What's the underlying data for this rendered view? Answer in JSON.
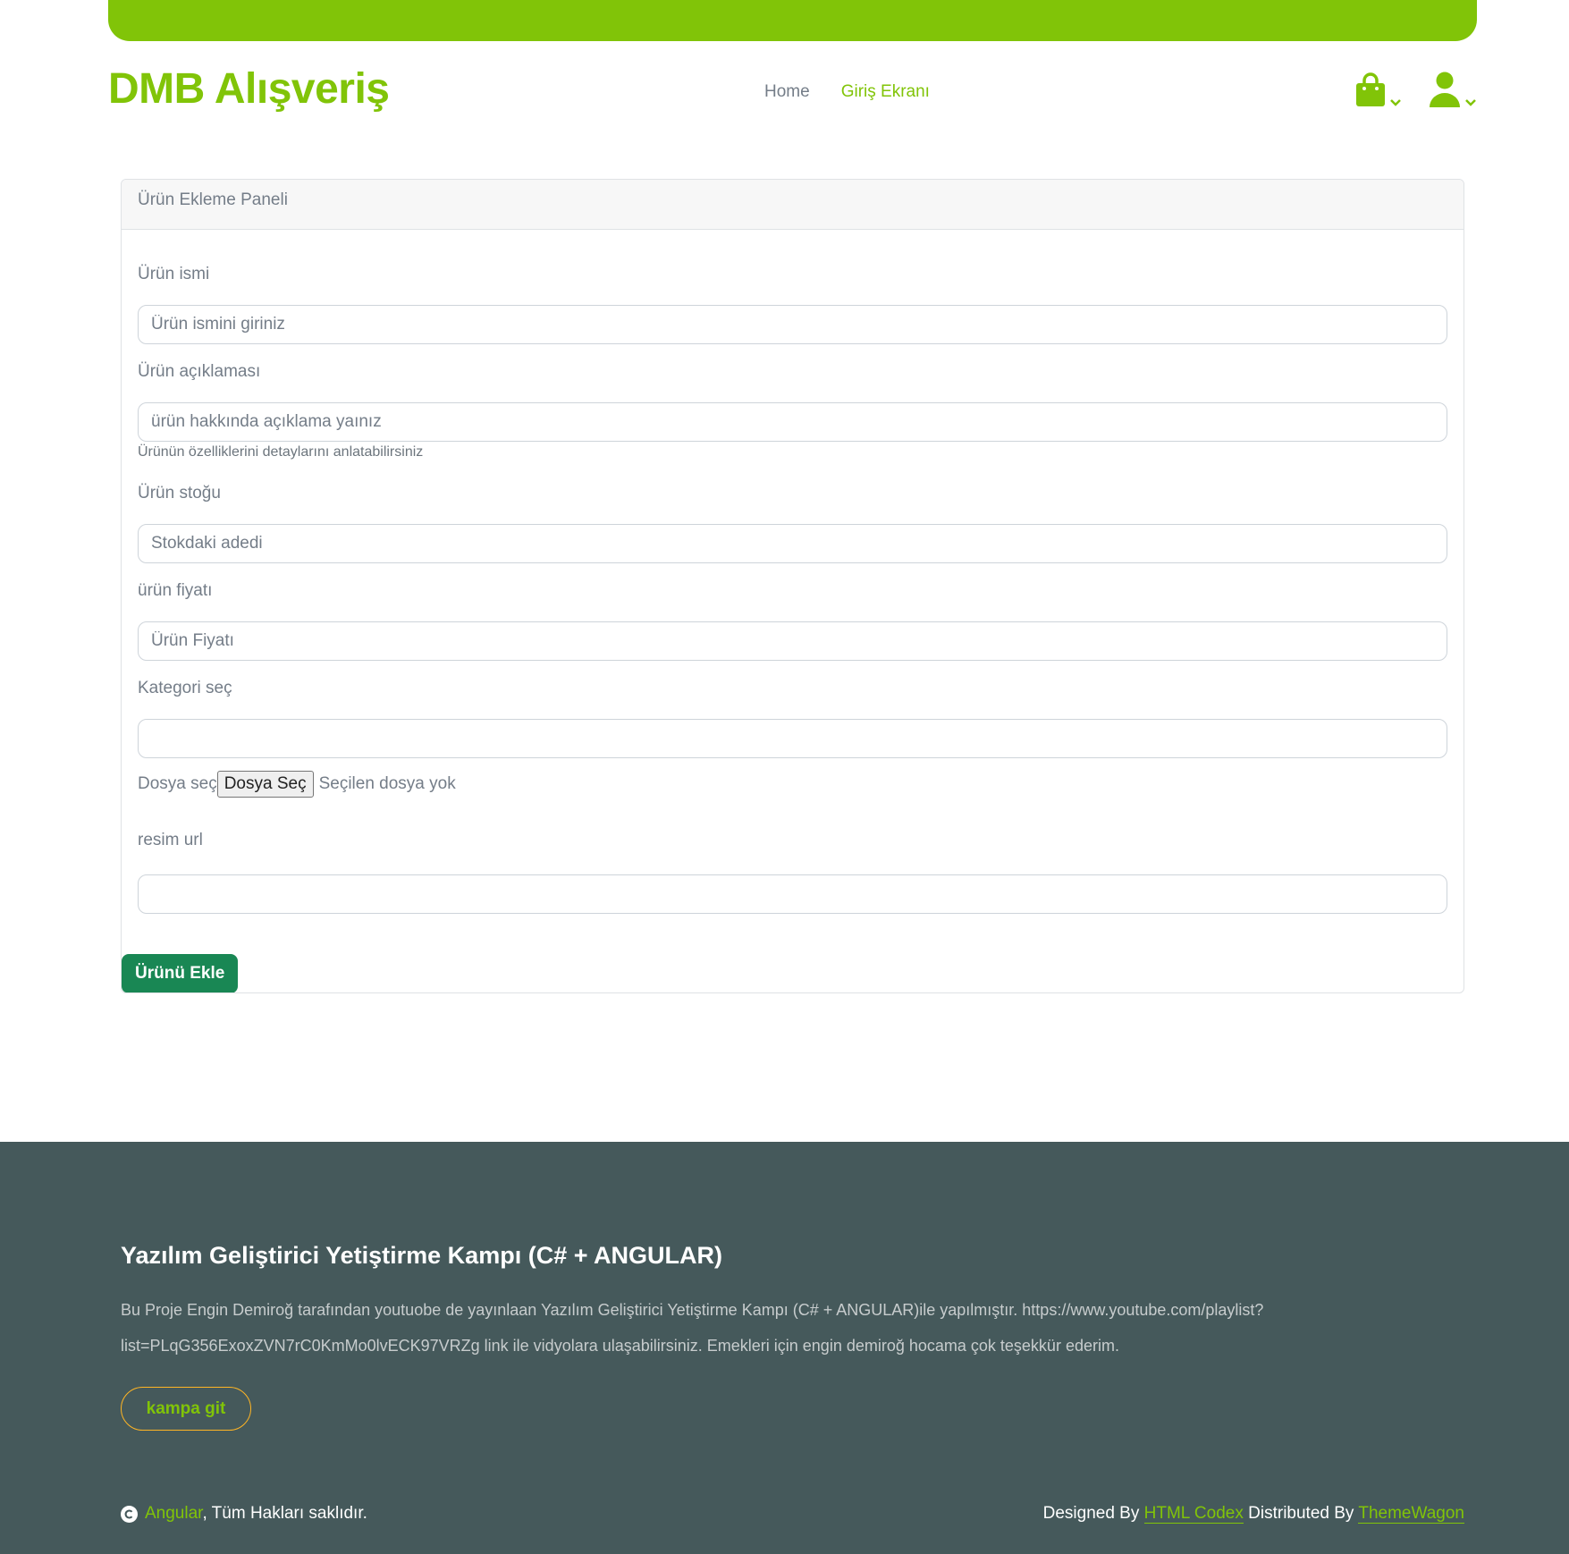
{
  "colors": {
    "brand": "#81c408",
    "footer_bg": "#45595b",
    "submit_bg": "#198754",
    "footer_btn_border": "#ffb524"
  },
  "navbar": {
    "brand": "DMB Alışveriş",
    "links": [
      {
        "label": "Home",
        "active": false
      },
      {
        "label": "Giriş Ekranı",
        "active": true
      }
    ],
    "icons": [
      "shopping-bag-icon",
      "user-icon"
    ]
  },
  "panel": {
    "title": "Ürün Ekleme Paneli",
    "name_label": "Ürün ismi",
    "name_placeholder": "Ürün ismini giriniz",
    "desc_label": "Ürün açıklaması",
    "desc_placeholder": "ürün hakkında açıklama yaınız",
    "desc_help": "Ürünün özelliklerini detaylarını anlatabilirsiniz",
    "stock_label": "Ürün stoğu",
    "stock_placeholder": "Stokdaki adedi",
    "price_label": "ürün fiyatı",
    "price_placeholder": "Ürün Fiyatı",
    "category_label": "Kategori seç",
    "file_label": "Dosya seç",
    "file_button": "Dosya Seç",
    "file_status": "Seçilen dosya yok",
    "image_url_label": "resim url",
    "submit": "Ürünü Ekle"
  },
  "footer": {
    "title": "Yazılım Geliştirici Yetiştirme Kampı (C# + ANGULAR)",
    "text": "Bu Proje Engin Demiroğ tarafından youtuobe de yayınlaan Yazılım Geliştirici Yetiştirme Kampı (C# + ANGULAR)ile yapılmıştır. https://www.youtube.com/playlist?list=PLqG356ExoxZVN7rC0KmMo0lvECK97VRZg link ile vidyolara ulaşabilirsiniz. Emekleri için engin demiroğ hocama çok teşekkür ederim.",
    "button": "kampa git",
    "copyright_link": "Angular",
    "copyright_text": ", Tüm Hakları saklıdır.",
    "designed_by": "Designed By",
    "designer": "HTML Codex",
    "distributed_by": "Distributed By",
    "distributor": "ThemeWagon"
  }
}
